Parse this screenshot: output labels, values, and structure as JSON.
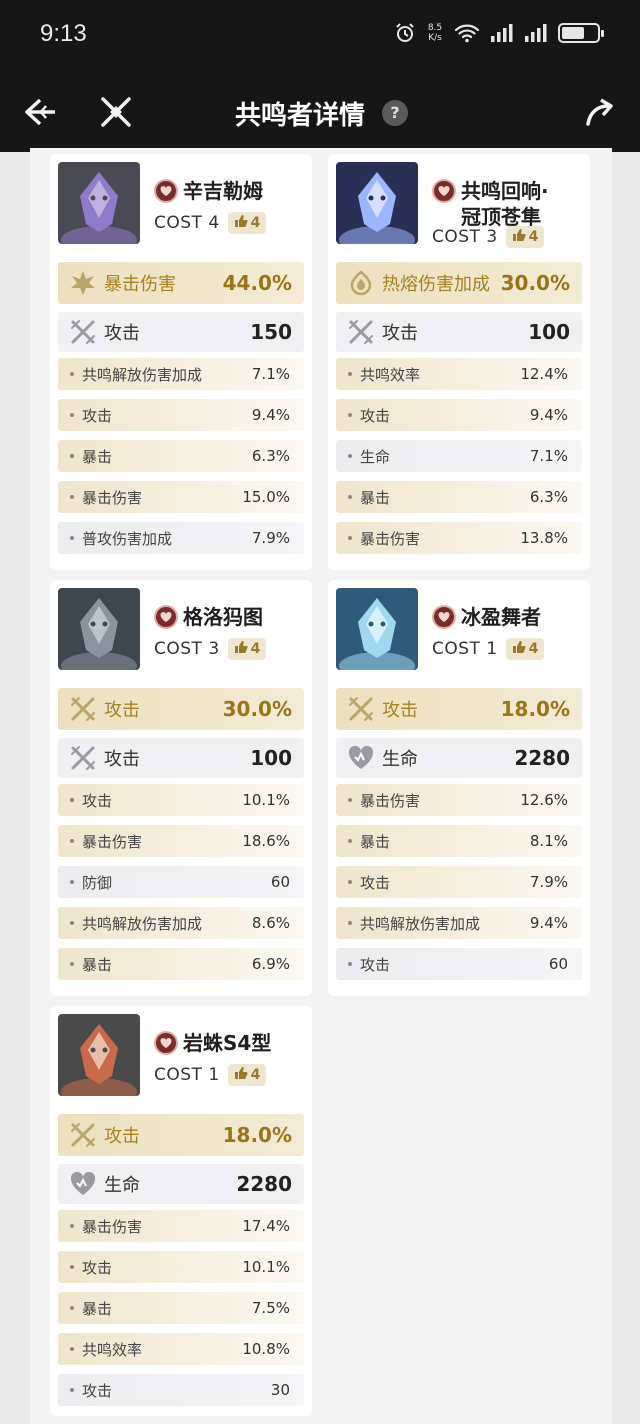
{
  "status_bar": {
    "time": "9:13",
    "speed_top": "8.5",
    "speed_unit": "K/s"
  },
  "nav": {
    "title": "共鸣者详情",
    "help": "?"
  },
  "echoes": [
    {
      "name": "辛吉勒姆",
      "cost": "COST 4",
      "level": "4",
      "main": {
        "label": "暴击伤害",
        "value": "44.0%",
        "icon": "crit-damage-icon"
      },
      "sub": {
        "label": "攻击",
        "value": "150",
        "icon": "attack-icon"
      },
      "stats": [
        {
          "label": "共鸣解放伤害加成",
          "value": "7.1%",
          "tone": "gold"
        },
        {
          "label": "攻击",
          "value": "9.4%",
          "tone": "gold"
        },
        {
          "label": "暴击",
          "value": "6.3%",
          "tone": "gold"
        },
        {
          "label": "暴击伤害",
          "value": "15.0%",
          "tone": "gold"
        },
        {
          "label": "普攻伤害加成",
          "value": "7.9%",
          "tone": "plain"
        }
      ]
    },
    {
      "name": "共鸣回响·冠顶苍隼",
      "name_line1": "共鸣回响·",
      "name_line2": "冠顶苍隼",
      "cost": "COST 3",
      "level": "4",
      "main": {
        "label": "热熔伤害加成",
        "value": "30.0%",
        "icon": "fusion-damage-icon"
      },
      "sub": {
        "label": "攻击",
        "value": "100",
        "icon": "attack-icon"
      },
      "stats": [
        {
          "label": "共鸣效率",
          "value": "12.4%",
          "tone": "gold"
        },
        {
          "label": "攻击",
          "value": "9.4%",
          "tone": "gold"
        },
        {
          "label": "生命",
          "value": "7.1%",
          "tone": "plain"
        },
        {
          "label": "暴击",
          "value": "6.3%",
          "tone": "gold"
        },
        {
          "label": "暴击伤害",
          "value": "13.8%",
          "tone": "gold"
        }
      ]
    },
    {
      "name": "格洛犸图",
      "cost": "COST 3",
      "level": "4",
      "main": {
        "label": "攻击",
        "value": "30.0%",
        "icon": "attack-icon"
      },
      "sub": {
        "label": "攻击",
        "value": "100",
        "icon": "attack-icon"
      },
      "stats": [
        {
          "label": "攻击",
          "value": "10.1%",
          "tone": "gold"
        },
        {
          "label": "暴击伤害",
          "value": "18.6%",
          "tone": "gold"
        },
        {
          "label": "防御",
          "value": "60",
          "tone": "plain"
        },
        {
          "label": "共鸣解放伤害加成",
          "value": "8.6%",
          "tone": "gold"
        },
        {
          "label": "暴击",
          "value": "6.9%",
          "tone": "gold"
        }
      ]
    },
    {
      "name": "冰盈舞者",
      "cost": "COST 1",
      "level": "4",
      "main": {
        "label": "攻击",
        "value": "18.0%",
        "icon": "attack-icon"
      },
      "sub": {
        "label": "生命",
        "value": "2280",
        "icon": "hp-icon"
      },
      "stats": [
        {
          "label": "暴击伤害",
          "value": "12.6%",
          "tone": "gold"
        },
        {
          "label": "暴击",
          "value": "8.1%",
          "tone": "gold"
        },
        {
          "label": "攻击",
          "value": "7.9%",
          "tone": "gold"
        },
        {
          "label": "共鸣解放伤害加成",
          "value": "9.4%",
          "tone": "gold"
        },
        {
          "label": "攻击",
          "value": "60",
          "tone": "plain"
        }
      ]
    },
    {
      "name": "岩蛛S4型",
      "cost": "COST 1",
      "level": "4",
      "main": {
        "label": "攻击",
        "value": "18.0%",
        "icon": "attack-icon"
      },
      "sub": {
        "label": "生命",
        "value": "2280",
        "icon": "hp-icon"
      },
      "stats": [
        {
          "label": "暴击伤害",
          "value": "17.4%",
          "tone": "gold"
        },
        {
          "label": "攻击",
          "value": "10.1%",
          "tone": "gold"
        },
        {
          "label": "暴击",
          "value": "7.5%",
          "tone": "gold"
        },
        {
          "label": "共鸣效率",
          "value": "10.8%",
          "tone": "gold"
        },
        {
          "label": "攻击",
          "value": "30",
          "tone": "plain"
        }
      ]
    }
  ],
  "colors": {
    "header_bg": "#161616",
    "gold_text": "#9a7416",
    "gold_bg": "#ece0bf",
    "page_bg": "#e9e9ea"
  }
}
